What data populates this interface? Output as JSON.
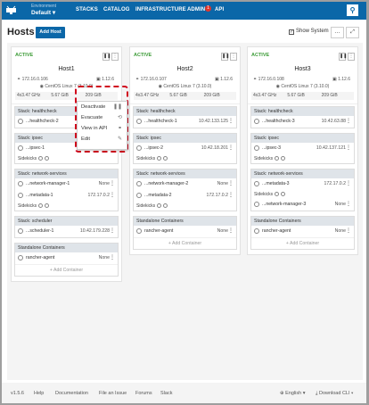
{
  "nav": {
    "env_label": "Environment",
    "env_value": "Default",
    "stacks": "STACKS",
    "catalog": "CATALOG",
    "infrastructure": "INFRASTRUCTURE",
    "admin": "ADMIN",
    "admin_badge": "1",
    "api": "API"
  },
  "page": {
    "title": "Hosts",
    "add_host": "Add Host",
    "show_system": "Show System",
    "show_system_checked": true
  },
  "menu": {
    "items": [
      {
        "label": "Deactivate",
        "icon": "pause-icon"
      },
      {
        "label": "Evacuate",
        "icon": "evacuate-icon"
      },
      {
        "label": "View in API",
        "icon": "link-icon"
      },
      {
        "label": "Edit",
        "icon": "edit-icon"
      }
    ]
  },
  "hosts": [
    {
      "state": "ACTIVE",
      "name": "Host1",
      "ip": "172.16.0.106",
      "docker": "1.12.6",
      "os": "CentOS Linux 7 (3.10.0)",
      "cpu": "4x3.47 GHz",
      "ram": "5.67 GiB",
      "disk": "209 GiB",
      "stacks": [
        {
          "title": "Stack: healthcheck",
          "items": [
            {
              "name": "...healthcheck-2",
              "value": "10.42.248.142"
            }
          ]
        },
        {
          "title": "Stack: ipsec",
          "items": [
            {
              "name": "...ipsec-1",
              "value": "10.42.42.111"
            }
          ],
          "sidekicks": "Sidekicks"
        },
        {
          "title": "Stack: network-services",
          "items": [
            {
              "name": "...network-manager-1",
              "value": "None"
            },
            {
              "name": "...metadata-1",
              "value": "172.17.0.2"
            }
          ],
          "sidekicks": "Sidekicks"
        },
        {
          "title": "Stack: scheduler",
          "items": [
            {
              "name": "...scheduler-1",
              "value": "10.42.179.228"
            }
          ]
        },
        {
          "title": "Standalone Containers",
          "items": [
            {
              "name": "rancher-agent",
              "value": "None"
            }
          ],
          "add": "Add Container"
        }
      ]
    },
    {
      "state": "ACTIVE",
      "name": "Host2",
      "ip": "172.16.0.107",
      "docker": "1.12.6",
      "os": "CentOS Linux 7 (3.10.0)",
      "cpu": "4x3.47 GHz",
      "ram": "5.67 GiB",
      "disk": "209 GiB",
      "stacks": [
        {
          "title": "Stack: healthcheck",
          "items": [
            {
              "name": "...healthcheck-1",
              "value": "10.42.133.125"
            }
          ]
        },
        {
          "title": "Stack: ipsec",
          "items": [
            {
              "name": "...ipsec-2",
              "value": "10.42.18.201"
            }
          ],
          "sidekicks": "Sidekicks"
        },
        {
          "title": "Stack: network-services",
          "items": [
            {
              "name": "...network-manager-2",
              "value": "None"
            },
            {
              "name": "...metadata-2",
              "value": "172.17.0.2"
            }
          ],
          "sidekicks": "Sidekicks"
        },
        {
          "title": "Standalone Containers",
          "items": [
            {
              "name": "rancher-agent",
              "value": "None"
            }
          ],
          "add": "Add Container"
        }
      ]
    },
    {
      "state": "ACTIVE",
      "name": "Host3",
      "ip": "172.16.0.108",
      "docker": "1.12.6",
      "os": "CentOS Linux 7 (3.10.0)",
      "cpu": "4x3.47 GHz",
      "ram": "5.67 GiB",
      "disk": "209 GiB",
      "stacks": [
        {
          "title": "Stack: healthcheck",
          "items": [
            {
              "name": "...healthcheck-3",
              "value": "10.42.63.88"
            }
          ]
        },
        {
          "title": "Stack: ipsec",
          "items": [
            {
              "name": "...ipsec-3",
              "value": "10.42.137.121"
            }
          ],
          "sidekicks": "Sidekicks"
        },
        {
          "title": "Stack: network-services",
          "items": [
            {
              "name": "...metadata-3",
              "value": "172.17.0.2"
            }
          ],
          "sidekicks": "Sidekicks",
          "items2": [
            {
              "name": "...network-manager-3",
              "value": "None"
            }
          ]
        },
        {
          "title": "Standalone Containers",
          "items": [
            {
              "name": "rancher-agent",
              "value": "None"
            }
          ],
          "add": "Add Container"
        }
      ]
    }
  ],
  "footer": {
    "version": "v1.5.6",
    "help": "Help",
    "documentation": "Documentation",
    "file_issue": "File an Issue",
    "forums": "Forums",
    "slack": "Slack",
    "language": "English",
    "download_cli": "Download CLI"
  },
  "colors": {
    "nav": "#0b67a8",
    "active": "#3c9b37",
    "highlight": "#d0021b"
  }
}
